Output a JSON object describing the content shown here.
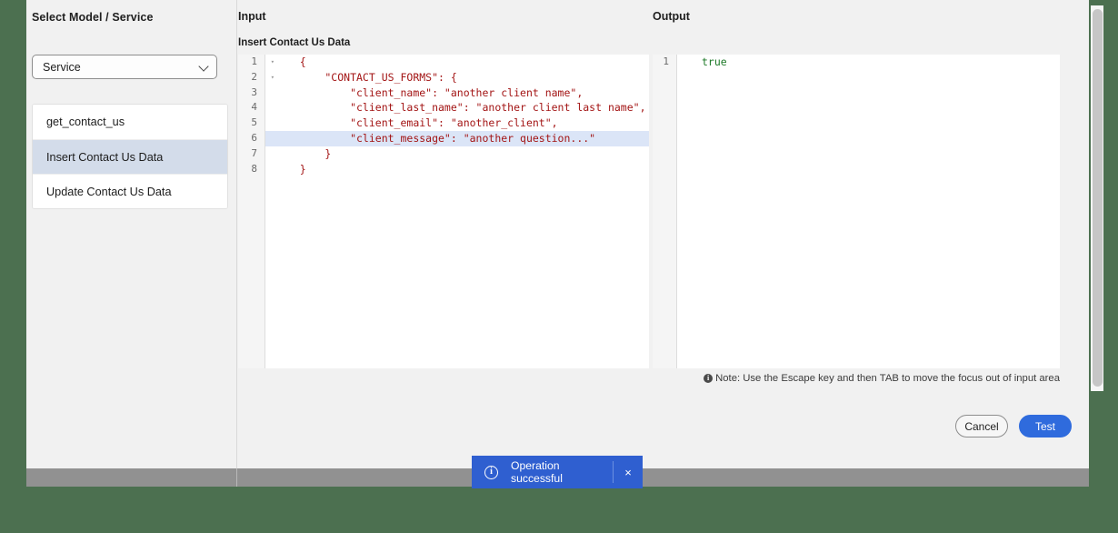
{
  "sidebar": {
    "title": "Select Model / Service",
    "select": {
      "value": "Service",
      "icon": "chevron-down-icon"
    },
    "items": [
      {
        "label": "get_contact_us",
        "selected": false
      },
      {
        "label": "Insert Contact Us Data",
        "selected": true
      },
      {
        "label": "Update Contact Us Data",
        "selected": false
      }
    ]
  },
  "input": {
    "title": "Input",
    "subtitle": "Insert Contact Us Data",
    "lines": [
      {
        "n": "1",
        "fold": "▾",
        "text": "    {",
        "highlight": false
      },
      {
        "n": "2",
        "fold": "▾",
        "text": "        \"CONTACT_US_FORMS\": {",
        "highlight": false
      },
      {
        "n": "3",
        "fold": "",
        "text": "            \"client_name\": \"another client name\",",
        "highlight": false
      },
      {
        "n": "4",
        "fold": "",
        "text": "            \"client_last_name\": \"another client last name\",",
        "highlight": false
      },
      {
        "n": "5",
        "fold": "",
        "text": "            \"client_email\": \"another_client\",",
        "highlight": false
      },
      {
        "n": "6",
        "fold": "",
        "text": "            \"client_message\": \"another question...\"",
        "highlight": true
      },
      {
        "n": "7",
        "fold": "",
        "text": "        }",
        "highlight": false
      },
      {
        "n": "8",
        "fold": "",
        "text": "    }",
        "highlight": false
      }
    ]
  },
  "output": {
    "title": "Output",
    "lines": [
      {
        "n": "1",
        "text": "true",
        "highlight": false
      }
    ]
  },
  "note": {
    "icon": "info-icon",
    "text": "Note: Use the Escape key and then TAB to move the focus out of input area"
  },
  "buttons": {
    "cancel": "Cancel",
    "test": "Test"
  },
  "toast": {
    "icon": "info-icon",
    "message": "Operation successful",
    "close": "×"
  },
  "colors": {
    "accent": "#2f6bdd",
    "toast_bg": "#2f5fd0",
    "selected_row": "#d3dcea",
    "code_string": "#a31515",
    "code_boolean": "#1d7a28",
    "page_bg": "#4c7050"
  }
}
